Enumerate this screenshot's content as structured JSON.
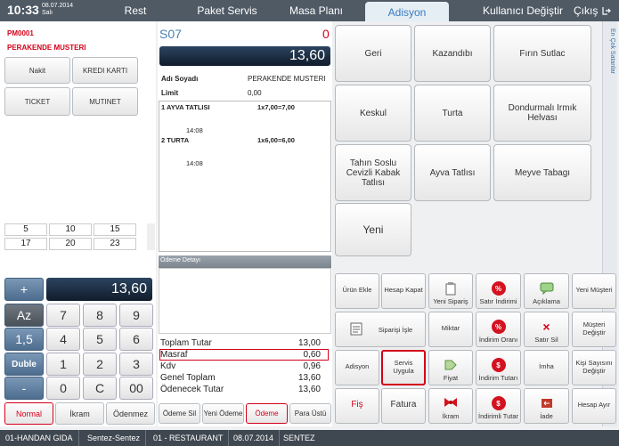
{
  "topbar": {
    "time": "10:33",
    "date": "08.07.2014",
    "day": "Salı",
    "tabs": [
      "Rest",
      "Paket Servis",
      "Masa Planı",
      "Adisyon"
    ],
    "user_change": "Kullanıcı Değiştir",
    "exit": "Çıkış"
  },
  "left": {
    "code": "PM0001",
    "customer": "PERAKENDE MUSTERI",
    "pay_buttons": [
      "Nakit",
      "KREDI KARTI",
      "TICKET",
      "MUTINET"
    ],
    "quick_values": [
      "5",
      "10",
      "15",
      "17",
      "20",
      "23"
    ],
    "display_value": "13,60",
    "keys": [
      "7",
      "8",
      "9",
      "4",
      "5",
      "6",
      "1",
      "2",
      "3",
      "0",
      "C",
      "00",
      "."
    ],
    "ops": [
      "+",
      "Az",
      "1,5",
      "Duble",
      "-"
    ],
    "modes": [
      "Normal",
      "İkram",
      "Ödenmez"
    ]
  },
  "mid": {
    "table": "S07",
    "table_count": "0",
    "total_display": "13,60",
    "name_label": "Adı Soyadı",
    "name_value": "PERAKENDE MUSTERI",
    "limit_label": "Limit",
    "limit_value": "0,00",
    "items": [
      {
        "name": "1 AYVA TATLISI",
        "qty": "1x7,00=7,00",
        "time": "14:08"
      },
      {
        "name": "2 TURTA",
        "qty": "1x6,00=6,00",
        "time": "14:08"
      }
    ],
    "payment_detail": "Ödeme Detayı",
    "summary": [
      {
        "label": "Toplam Tutar",
        "value": "13,00"
      },
      {
        "label": "Masraf",
        "value": "0,60"
      },
      {
        "label": "Kdv",
        "value": "0,96"
      },
      {
        "label": "Genel Toplam",
        "value": "13,60"
      },
      {
        "label": "Ödenecek Tutar",
        "value": "13,60"
      }
    ],
    "bottom_buttons": [
      "Ödeme Sil",
      "Yeni Ödeme",
      "Ödeme",
      "Para Üstü"
    ]
  },
  "products": [
    "Geri",
    "Kazandıbı",
    "Fırın Sutlac",
    "Keskul",
    "Turta",
    "Dondurmalı Irmık Helvası",
    "Tahın Soslu Cevizli Kabak Tatlısı",
    "Ayva Tatlısı",
    "Meyve Tabagı",
    "Yeni"
  ],
  "side_label": "En Çok Satanlar",
  "actions": {
    "urun_ekle": "Ürün Ekle",
    "hesap_kapat": "Hesap Kapat",
    "yeni_siparis": "Yeni Sipariş",
    "satir_indirimi": "Satır İndirimi",
    "aciklama": "Açıklama",
    "yeni_musteri": "Yeni Müşteri",
    "siparisi_isle": "Siparişi İşle",
    "miktar": "Miktar",
    "indirim_orani": "İndirim Oranı",
    "satir_sil": "Satır Sil",
    "musteri_degistir": "Müşteri Değiştir",
    "adisyon": "Adisyon",
    "servis_uygula": "Servis Uygula",
    "fiyat": "Fiyat",
    "indirim_tutari": "İndirim Tutarı",
    "imha": "İmha",
    "kisi_sayisini_degistir": "Kişi Sayısını Değiştir",
    "fis": "Fiş",
    "fatura": "Fatura",
    "ikram": "İkram",
    "indirimli_tutar": "İndirimli Tutar",
    "iade": "İade",
    "hesap_ayir": "Hesap Ayır"
  },
  "status": [
    "01-HANDAN GIDA",
    "Sentez-Sentez",
    "01 - RESTAURANT",
    "08.07.2014",
    "SENTEZ"
  ],
  "colors": {
    "accent_red": "#d4001a",
    "topbar": "#4f5a65",
    "display": "#1f3247"
  }
}
